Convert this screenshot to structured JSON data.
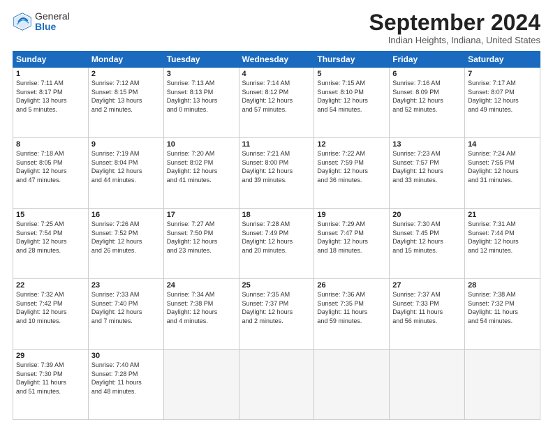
{
  "logo": {
    "general": "General",
    "blue": "Blue"
  },
  "header": {
    "month": "September 2024",
    "location": "Indian Heights, Indiana, United States"
  },
  "days_of_week": [
    "Sunday",
    "Monday",
    "Tuesday",
    "Wednesday",
    "Thursday",
    "Friday",
    "Saturday"
  ],
  "weeks": [
    [
      {
        "day": "1",
        "sunrise": "7:11 AM",
        "sunset": "8:17 PM",
        "daylight": "13 hours and 5 minutes."
      },
      {
        "day": "2",
        "sunrise": "7:12 AM",
        "sunset": "8:15 PM",
        "daylight": "13 hours and 2 minutes."
      },
      {
        "day": "3",
        "sunrise": "7:13 AM",
        "sunset": "8:13 PM",
        "daylight": "13 hours and 0 minutes."
      },
      {
        "day": "4",
        "sunrise": "7:14 AM",
        "sunset": "8:12 PM",
        "daylight": "12 hours and 57 minutes."
      },
      {
        "day": "5",
        "sunrise": "7:15 AM",
        "sunset": "8:10 PM",
        "daylight": "12 hours and 54 minutes."
      },
      {
        "day": "6",
        "sunrise": "7:16 AM",
        "sunset": "8:09 PM",
        "daylight": "12 hours and 52 minutes."
      },
      {
        "day": "7",
        "sunrise": "7:17 AM",
        "sunset": "8:07 PM",
        "daylight": "12 hours and 49 minutes."
      }
    ],
    [
      {
        "day": "8",
        "sunrise": "7:18 AM",
        "sunset": "8:05 PM",
        "daylight": "12 hours and 47 minutes."
      },
      {
        "day": "9",
        "sunrise": "7:19 AM",
        "sunset": "8:04 PM",
        "daylight": "12 hours and 44 minutes."
      },
      {
        "day": "10",
        "sunrise": "7:20 AM",
        "sunset": "8:02 PM",
        "daylight": "12 hours and 41 minutes."
      },
      {
        "day": "11",
        "sunrise": "7:21 AM",
        "sunset": "8:00 PM",
        "daylight": "12 hours and 39 minutes."
      },
      {
        "day": "12",
        "sunrise": "7:22 AM",
        "sunset": "7:59 PM",
        "daylight": "12 hours and 36 minutes."
      },
      {
        "day": "13",
        "sunrise": "7:23 AM",
        "sunset": "7:57 PM",
        "daylight": "12 hours and 33 minutes."
      },
      {
        "day": "14",
        "sunrise": "7:24 AM",
        "sunset": "7:55 PM",
        "daylight": "12 hours and 31 minutes."
      }
    ],
    [
      {
        "day": "15",
        "sunrise": "7:25 AM",
        "sunset": "7:54 PM",
        "daylight": "12 hours and 28 minutes."
      },
      {
        "day": "16",
        "sunrise": "7:26 AM",
        "sunset": "7:52 PM",
        "daylight": "12 hours and 26 minutes."
      },
      {
        "day": "17",
        "sunrise": "7:27 AM",
        "sunset": "7:50 PM",
        "daylight": "12 hours and 23 minutes."
      },
      {
        "day": "18",
        "sunrise": "7:28 AM",
        "sunset": "7:49 PM",
        "daylight": "12 hours and 20 minutes."
      },
      {
        "day": "19",
        "sunrise": "7:29 AM",
        "sunset": "7:47 PM",
        "daylight": "12 hours and 18 minutes."
      },
      {
        "day": "20",
        "sunrise": "7:30 AM",
        "sunset": "7:45 PM",
        "daylight": "12 hours and 15 minutes."
      },
      {
        "day": "21",
        "sunrise": "7:31 AM",
        "sunset": "7:44 PM",
        "daylight": "12 hours and 12 minutes."
      }
    ],
    [
      {
        "day": "22",
        "sunrise": "7:32 AM",
        "sunset": "7:42 PM",
        "daylight": "12 hours and 10 minutes."
      },
      {
        "day": "23",
        "sunrise": "7:33 AM",
        "sunset": "7:40 PM",
        "daylight": "12 hours and 7 minutes."
      },
      {
        "day": "24",
        "sunrise": "7:34 AM",
        "sunset": "7:38 PM",
        "daylight": "12 hours and 4 minutes."
      },
      {
        "day": "25",
        "sunrise": "7:35 AM",
        "sunset": "7:37 PM",
        "daylight": "12 hours and 2 minutes."
      },
      {
        "day": "26",
        "sunrise": "7:36 AM",
        "sunset": "7:35 PM",
        "daylight": "11 hours and 59 minutes."
      },
      {
        "day": "27",
        "sunrise": "7:37 AM",
        "sunset": "7:33 PM",
        "daylight": "11 hours and 56 minutes."
      },
      {
        "day": "28",
        "sunrise": "7:38 AM",
        "sunset": "7:32 PM",
        "daylight": "11 hours and 54 minutes."
      }
    ],
    [
      {
        "day": "29",
        "sunrise": "7:39 AM",
        "sunset": "7:30 PM",
        "daylight": "11 hours and 51 minutes."
      },
      {
        "day": "30",
        "sunrise": "7:40 AM",
        "sunset": "7:28 PM",
        "daylight": "11 hours and 48 minutes."
      },
      null,
      null,
      null,
      null,
      null
    ]
  ]
}
